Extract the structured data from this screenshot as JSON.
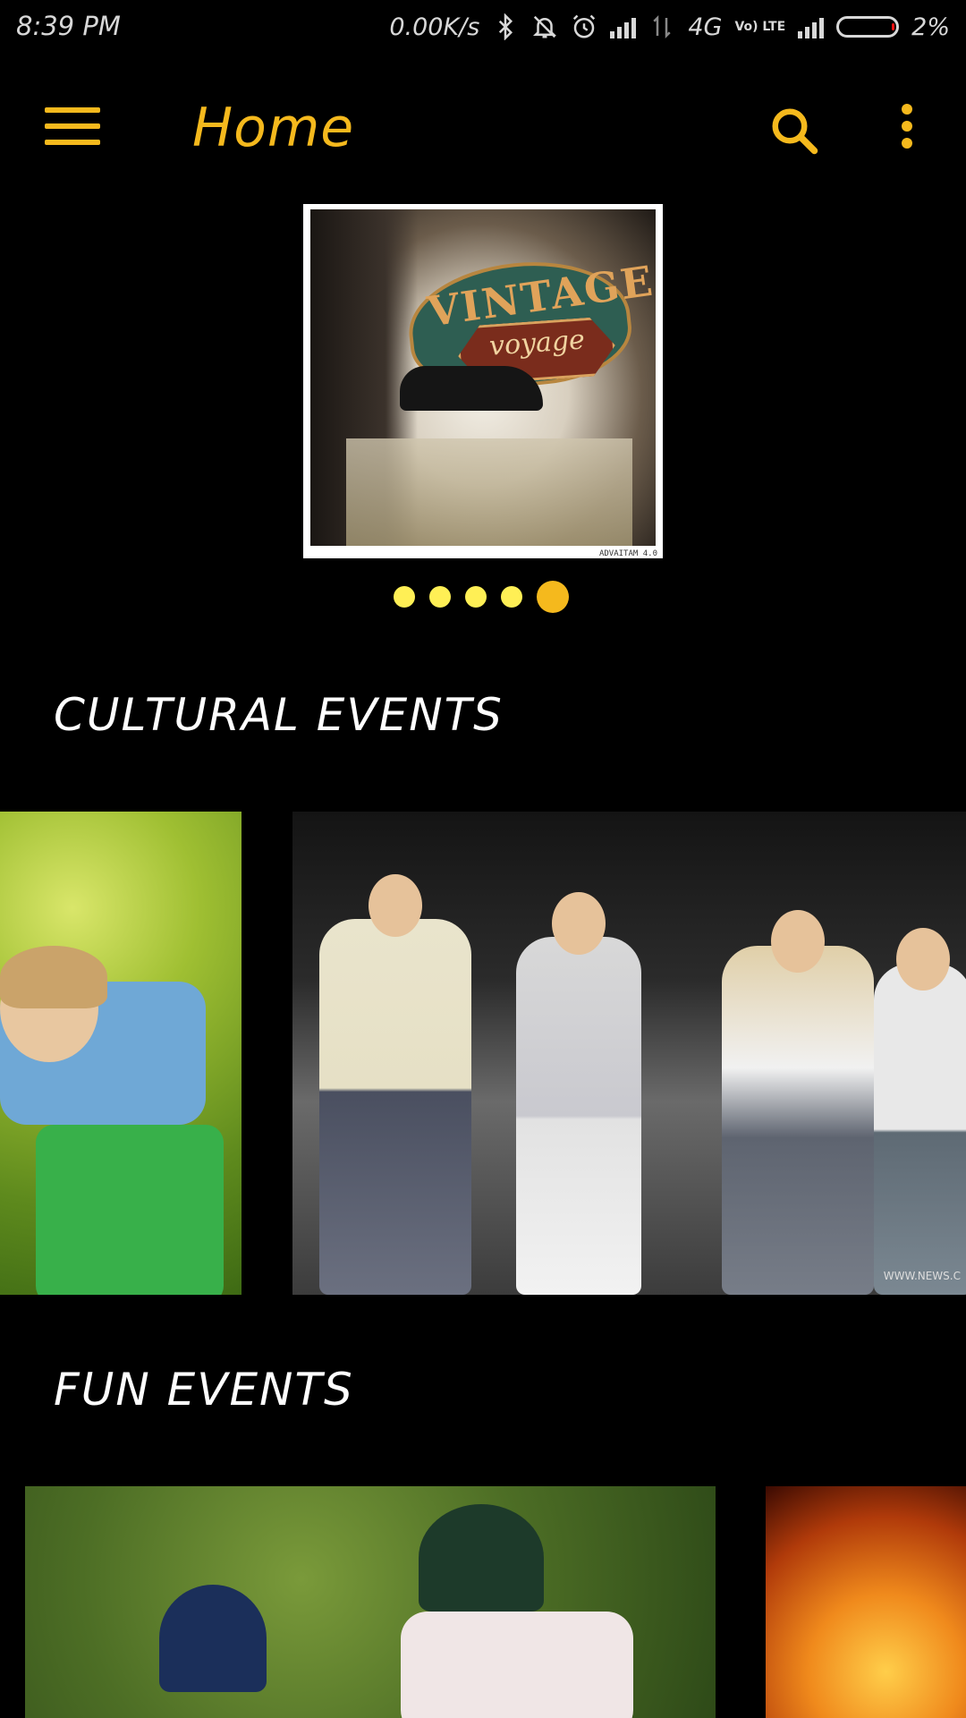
{
  "status_bar": {
    "time": "8:39 PM",
    "network_speed": "0.00K/s",
    "network_type": "4G",
    "volte_label": "Vo) LTE",
    "battery": "2%"
  },
  "app_bar": {
    "title": "Home",
    "accent_color": "#f5b91d"
  },
  "banner": {
    "image_text": "VINTAGE",
    "image_subtext": "voyage",
    "caption": "ADVAITAM 4.0",
    "indicator_count": 5,
    "active_index": 4
  },
  "sections": [
    {
      "title": "CULTURAL EVENTS",
      "cards": [
        {
          "image": "child-dancing-photo"
        },
        {
          "image": "fashion-show-photo",
          "watermark": "WWW.NEWS.C"
        }
      ]
    },
    {
      "title": "FUN EVENTS",
      "cards": [
        {
          "image": "cricket-players-photo"
        },
        {
          "image": "fire-basketball-photo"
        }
      ]
    }
  ]
}
